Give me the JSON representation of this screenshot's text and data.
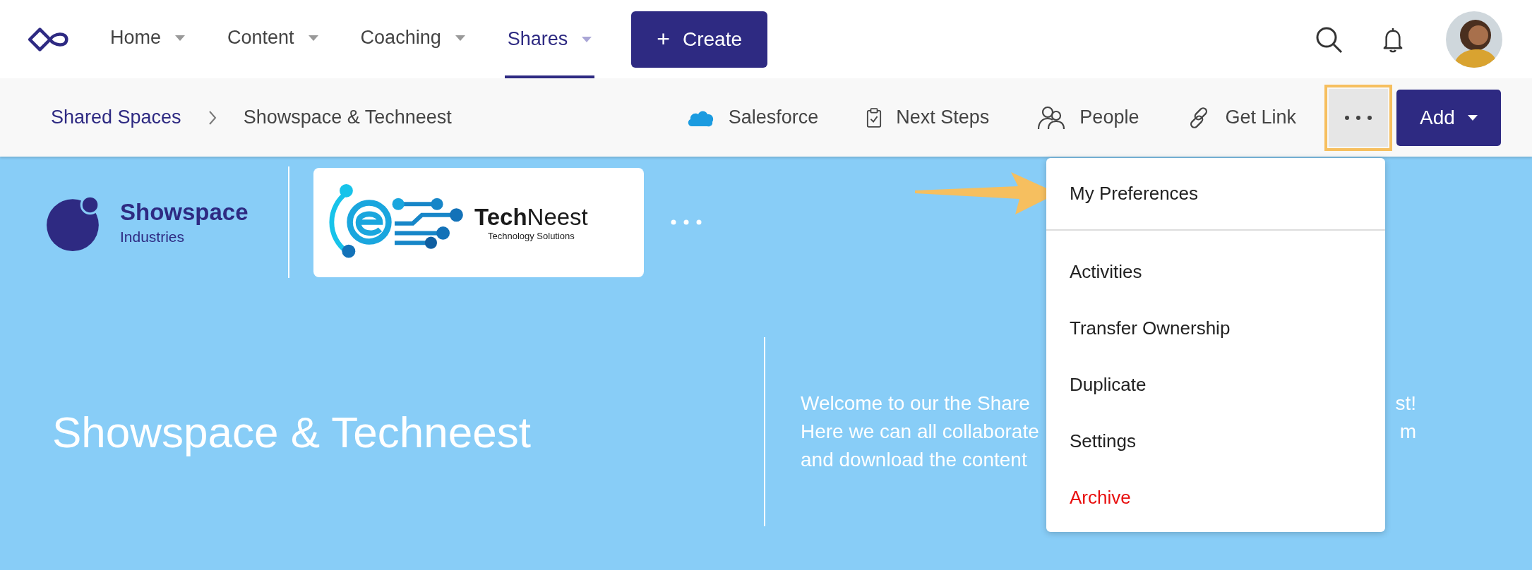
{
  "nav": {
    "items": [
      {
        "label": "Home",
        "selected": false
      },
      {
        "label": "Content",
        "selected": false
      },
      {
        "label": "Coaching",
        "selected": false
      },
      {
        "label": "Shares",
        "selected": true
      }
    ],
    "create_button": {
      "icon": "+",
      "label": "Create"
    }
  },
  "breadcrumb": [
    "Shared Spaces",
    "Showspace & Techneest"
  ],
  "actions": [
    {
      "kind": "salesforce",
      "label": "Salesforce"
    },
    {
      "kind": "clipboard",
      "label": "Next Steps"
    },
    {
      "kind": "people",
      "label": "People"
    },
    {
      "kind": "link",
      "label": "Get Link"
    }
  ],
  "more_button": {
    "expanded": true
  },
  "add_button": {
    "label": "Add"
  },
  "logos": {
    "showspace": {
      "name": "Showspace",
      "sub": "Industries"
    },
    "techneest": {
      "name": "**Tech**Neest",
      "sub": "Technology Solutions"
    }
  },
  "hero": {
    "title": "Showspace & Techneest",
    "welcome": [
      {
        "left": "Welcome to our the Share",
        "right": "st!"
      },
      {
        "left": "Here we can all collaborate",
        "right": "m"
      },
      {
        "left": "and download the content"
      }
    ]
  },
  "menu": {
    "groups": [
      [
        {
          "label": "My Preferences",
          "kind": "normal"
        }
      ],
      [
        {
          "label": "Activities",
          "kind": "normal"
        },
        {
          "label": "Transfer Ownership",
          "kind": "normal"
        },
        {
          "label": "Duplicate",
          "kind": "normal"
        },
        {
          "label": "Settings",
          "kind": "normal"
        },
        {
          "label": "Archive",
          "kind": "danger"
        }
      ]
    ]
  }
}
